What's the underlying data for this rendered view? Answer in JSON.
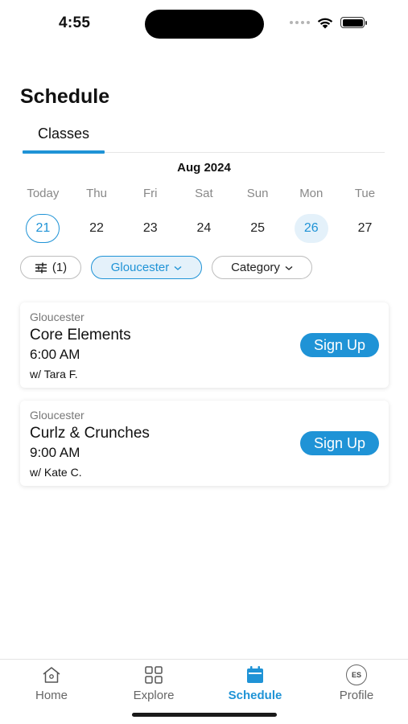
{
  "status_bar": {
    "time": "4:55"
  },
  "header": {
    "title": "Schedule"
  },
  "tabs": [
    {
      "label": "Classes",
      "active": true
    }
  ],
  "calendar": {
    "month": "Aug 2024",
    "days": [
      {
        "name": "Today",
        "date": "21",
        "state": "today"
      },
      {
        "name": "Thu",
        "date": "22",
        "state": ""
      },
      {
        "name": "Fri",
        "date": "23",
        "state": ""
      },
      {
        "name": "Sat",
        "date": "24",
        "state": ""
      },
      {
        "name": "Sun",
        "date": "25",
        "state": ""
      },
      {
        "name": "Mon",
        "date": "26",
        "state": "selected"
      },
      {
        "name": "Tue",
        "date": "27",
        "state": ""
      }
    ]
  },
  "filters": {
    "filter_count": "(1)",
    "location": "Gloucester",
    "category": "Category"
  },
  "classes": [
    {
      "location": "Gloucester",
      "title": "Core Elements",
      "time": "6:00 AM",
      "instructor": "w/ Tara F.",
      "button": "Sign Up"
    },
    {
      "location": "Gloucester",
      "title": "Curlz & Crunches",
      "time": "9:00 AM",
      "instructor": "w/ Kate C.",
      "button": "Sign Up"
    }
  ],
  "bottom_nav": {
    "home": "Home",
    "explore": "Explore",
    "schedule": "Schedule",
    "profile": "Profile",
    "profile_initials": "ES"
  },
  "colors": {
    "accent": "#1f93d6",
    "accent_light": "#e4f1fa"
  }
}
